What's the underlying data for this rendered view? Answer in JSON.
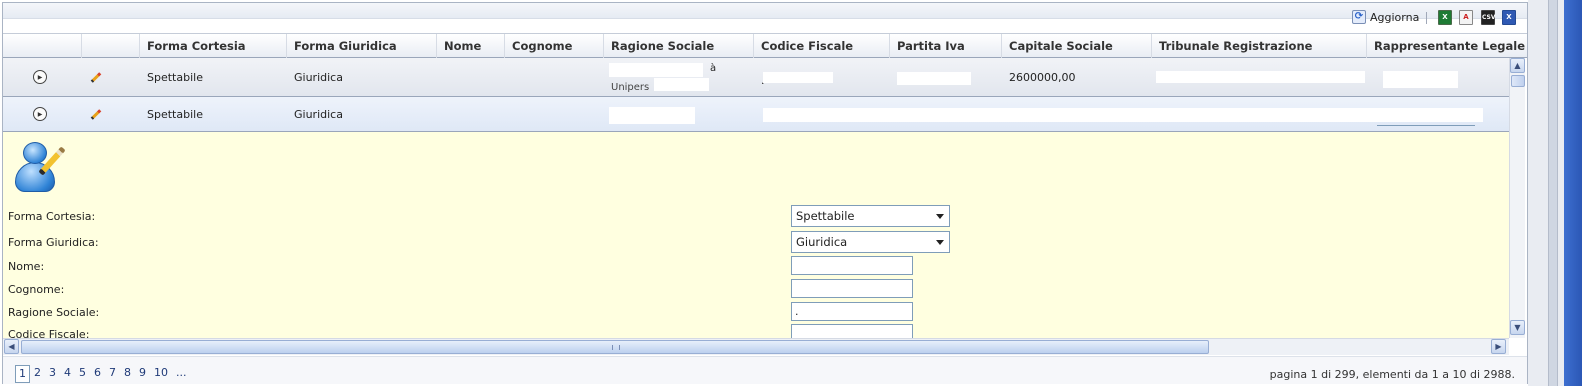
{
  "toolbar": {
    "refresh_label": "Aggiorna",
    "export_icons": [
      "excel-export-icon",
      "pdf-export-icon",
      "csv-export-icon",
      "excel-alt-export-icon"
    ]
  },
  "grid": {
    "columns": [
      "Forma Cortesia",
      "Forma Giuridica",
      "Nome",
      "Cognome",
      "Ragione Sociale",
      "Codice Fiscale",
      "Partita Iva",
      "Capitale Sociale",
      "Tribunale Registrazione",
      "Rappresentante Legale"
    ],
    "rows": [
      {
        "forma_cortesia": "Spettabile",
        "forma_giuridica": "Giuridica",
        "ragione_sociale_fragment": "à",
        "ragione_sociale_fragment2": "Unipers",
        "codice_fiscale_fragment": ".",
        "capitale_sociale": "2600000,00"
      },
      {
        "forma_cortesia": "Spettabile",
        "forma_giuridica": "Giuridica"
      }
    ]
  },
  "detail": {
    "fields": {
      "forma_cortesia": {
        "label": "Forma Cortesia:",
        "value": "Spettabile"
      },
      "forma_giuridica": {
        "label": "Forma Giuridica:",
        "value": "Giuridica"
      },
      "nome": {
        "label": "Nome:",
        "value": ""
      },
      "cognome": {
        "label": "Cognome:",
        "value": ""
      },
      "ragione_sociale": {
        "label": "Ragione Sociale:",
        "value": "."
      },
      "codice_fiscale": {
        "label": "Codice Fiscale:",
        "value": ""
      }
    }
  },
  "pager": {
    "pages": [
      "1",
      "2",
      "3",
      "4",
      "5",
      "6",
      "7",
      "8",
      "9",
      "10",
      "..."
    ],
    "current": "1",
    "info": "pagina 1 di 299, elementi da 1 a 10 di 2988."
  }
}
